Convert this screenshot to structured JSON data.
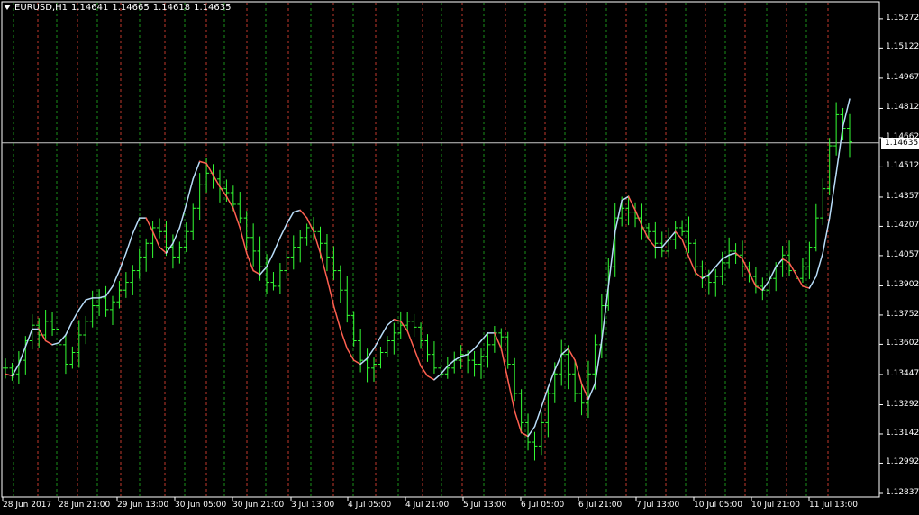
{
  "header": {
    "symbol": "EURUSD,H1",
    "open": "1.14641",
    "high": "1.14665",
    "low": "1.14618",
    "close": "1.14635"
  },
  "current_price": "1.14635",
  "colors": {
    "background": "#000000",
    "bull_bar": "#33ff33",
    "bear_bar": "#33ff33",
    "smooth_up": "#b8dcf8",
    "smooth_down": "#ff6050",
    "vline_green": "#1a8f1a",
    "vline_red": "#c0392b",
    "price_line": "#c8c8c8",
    "axis": "#ffffff"
  },
  "chart_data": {
    "type": "line",
    "ylim": [
      1.12837,
      1.1535
    ],
    "y_ticks": [
      "1.15272",
      "1.15122",
      "1.14967",
      "1.14812",
      "1.14662",
      "1.14512",
      "1.14357",
      "1.14207",
      "1.14057",
      "1.13902",
      "1.13752",
      "1.13602",
      "1.13447",
      "1.13292",
      "1.13142",
      "1.12992",
      "1.12837"
    ],
    "x_ticks": [
      "28 Jun 2017",
      "28 Jun 21:00",
      "29 Jun 13:00",
      "30 Jun 05:00",
      "30 Jun 21:00",
      "3 Jul 13:00",
      "4 Jul 05:00",
      "4 Jul 21:00",
      "5 Jul 13:00",
      "6 Jul 05:00",
      "6 Jul 21:00",
      "7 Jul 13:00",
      "10 Jul 05:00",
      "10 Jul 21:00",
      "11 Jul 13:00"
    ],
    "series": [
      {
        "kind": "close",
        "values": [
          1.1348,
          1.1345,
          1.1352,
          1.1362,
          1.137,
          1.1365,
          1.1372,
          1.1368,
          1.136,
          1.135,
          1.1356,
          1.1365,
          1.1372,
          1.138,
          1.1384,
          1.1378,
          1.1382,
          1.1388,
          1.1392,
          1.1398,
          1.1405,
          1.1412,
          1.142,
          1.1418,
          1.141,
          1.1405,
          1.141,
          1.1418,
          1.143,
          1.1442,
          1.1448,
          1.1445,
          1.144,
          1.1438,
          1.1432,
          1.1425,
          1.1415,
          1.1408,
          1.14,
          1.1392,
          1.139,
          1.1398,
          1.1405,
          1.141,
          1.1415,
          1.142,
          1.1418,
          1.1412,
          1.1405,
          1.1398,
          1.1388,
          1.1375,
          1.1362,
          1.1352,
          1.1348,
          1.135,
          1.1356,
          1.1362,
          1.1366,
          1.137,
          1.1372,
          1.1369,
          1.1362,
          1.1355,
          1.1348,
          1.1345,
          1.1348,
          1.1352,
          1.1355,
          1.1352,
          1.135,
          1.1354,
          1.136,
          1.1366,
          1.1364,
          1.135,
          1.1335,
          1.132,
          1.131,
          1.1308,
          1.132,
          1.1335,
          1.1345,
          1.1355,
          1.1345,
          1.1335,
          1.133,
          1.1345,
          1.136,
          1.138,
          1.14,
          1.1425,
          1.143,
          1.1428,
          1.1425,
          1.142,
          1.1418,
          1.1412,
          1.1408,
          1.1414,
          1.142,
          1.1418,
          1.1412,
          1.14,
          1.1395,
          1.1392,
          1.1395,
          1.1402,
          1.1408,
          1.1406,
          1.14,
          1.1395,
          1.139,
          1.1388,
          1.1394,
          1.14,
          1.1406,
          1.1398,
          1.1394,
          1.14,
          1.141,
          1.1425,
          1.144,
          1.1462,
          1.1478,
          1.1471,
          1.1464
        ]
      },
      {
        "kind": "smoothed",
        "values": [
          1.1345,
          1.1344,
          1.135,
          1.1359,
          1.1368,
          1.1368,
          1.1362,
          1.136,
          1.1361,
          1.1365,
          1.1372,
          1.1378,
          1.1383,
          1.1384,
          1.1384,
          1.1385,
          1.139,
          1.1398,
          1.1407,
          1.1417,
          1.1425,
          1.1425,
          1.1418,
          1.141,
          1.1407,
          1.1412,
          1.142,
          1.1432,
          1.1445,
          1.1454,
          1.1453,
          1.1447,
          1.1441,
          1.1436,
          1.143,
          1.142,
          1.1407,
          1.1398,
          1.1396,
          1.14,
          1.1407,
          1.1415,
          1.1422,
          1.1428,
          1.1429,
          1.1425,
          1.1418,
          1.1407,
          1.1394,
          1.138,
          1.1368,
          1.1358,
          1.1352,
          1.135,
          1.1353,
          1.1358,
          1.1364,
          1.137,
          1.1373,
          1.1372,
          1.1367,
          1.1358,
          1.1349,
          1.1344,
          1.1342,
          1.1345,
          1.1349,
          1.1352,
          1.1354,
          1.1355,
          1.1358,
          1.1362,
          1.1366,
          1.1366,
          1.1358,
          1.1342,
          1.1326,
          1.1315,
          1.1313,
          1.1318,
          1.1328,
          1.1338,
          1.1347,
          1.1355,
          1.1358,
          1.1352,
          1.134,
          1.1332,
          1.134,
          1.1362,
          1.139,
          1.1418,
          1.1434,
          1.1436,
          1.1429,
          1.1421,
          1.1414,
          1.141,
          1.141,
          1.1414,
          1.1418,
          1.1414,
          1.1405,
          1.1397,
          1.1394,
          1.1396,
          1.14,
          1.1404,
          1.1406,
          1.1407,
          1.1404,
          1.1397,
          1.139,
          1.1388,
          1.1393,
          1.14,
          1.1404,
          1.1402,
          1.1396,
          1.139,
          1.1389,
          1.1395,
          1.1407,
          1.1425,
          1.1448,
          1.1472,
          1.1486
        ]
      }
    ]
  }
}
